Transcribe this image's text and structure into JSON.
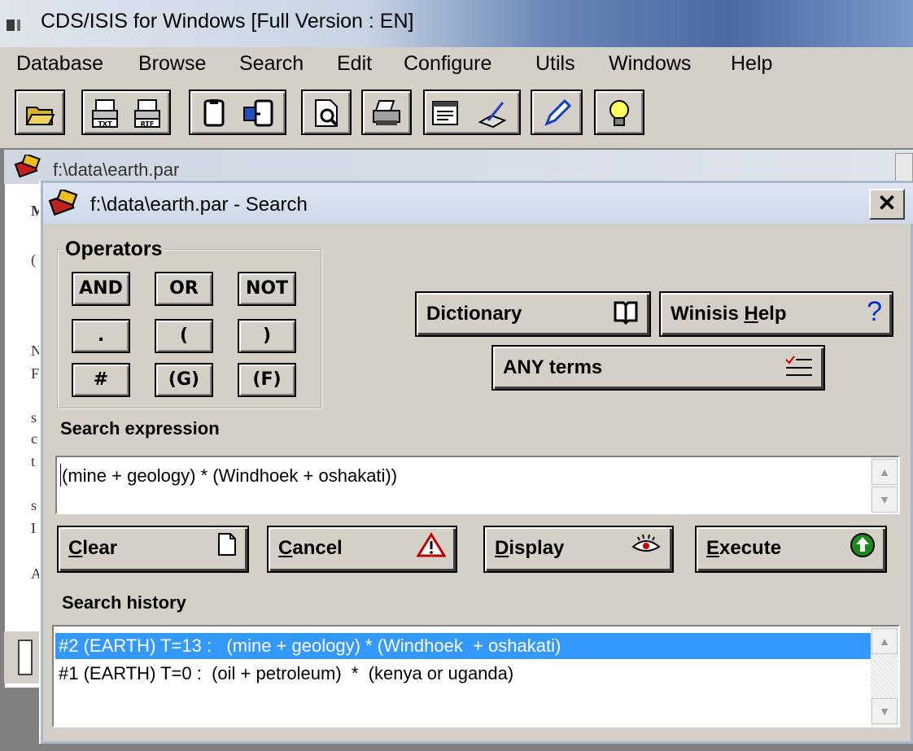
{
  "app": {
    "title": "CDS/ISIS for Windows [Full Version : EN]",
    "menu": [
      "Database",
      "Browse",
      "Search",
      "Edit",
      "Configure",
      "Utils",
      "Windows",
      "Help"
    ],
    "toolbar_icons": [
      "open-folder-icon",
      "print-txt-icon",
      "print-rtf-icon",
      "clipboard-icon",
      "clipboard-copy-icon",
      "find-icon",
      "printer-icon",
      "form-icon",
      "edit-record-icon",
      "pencil-icon",
      "lightbulb-icon"
    ],
    "toolbar_labels": {
      "txt": "TXT",
      "rtf": "RTF"
    }
  },
  "child_window": {
    "title": "f:\\data\\earth.par",
    "left_chars": [
      "M",
      "(",
      "N",
      "F",
      "s",
      "c",
      "t",
      "s",
      "I",
      "A"
    ]
  },
  "dialog": {
    "title": "f:\\data\\earth.par - Search",
    "close": "✕",
    "operators": {
      "legend": "Operators",
      "buttons": [
        "AND",
        "OR",
        "NOT",
        ".",
        "(",
        ")",
        "#",
        "(G)",
        "(F)"
      ]
    },
    "dictionary_label": "Dictionary",
    "help_label_pre": "Winisis ",
    "help_label_u": "H",
    "help_label_post": "elp",
    "help_icon": "?",
    "any_terms_label": "ANY terms",
    "search_expression_label": "Search expression",
    "search_expression": "(mine + geology) * (Windhoek  + oshakati))",
    "clear": {
      "u": "C",
      "rest": "lear"
    },
    "cancel": {
      "u": "C",
      "rest": "ancel"
    },
    "display": {
      "u": "D",
      "rest": "isplay"
    },
    "execute": {
      "u": "E",
      "rest": "xecute"
    },
    "search_history_label": "Search history",
    "history": [
      "#2 (EARTH) T=13 :   (mine + geology) * (Windhoek  + oshakati)",
      "#1 (EARTH) T=0 :  (oil + petroleum)  *  (kenya or uganda)"
    ]
  },
  "colors": {
    "selection": "#3399ff",
    "face": "#d4d0c8"
  }
}
